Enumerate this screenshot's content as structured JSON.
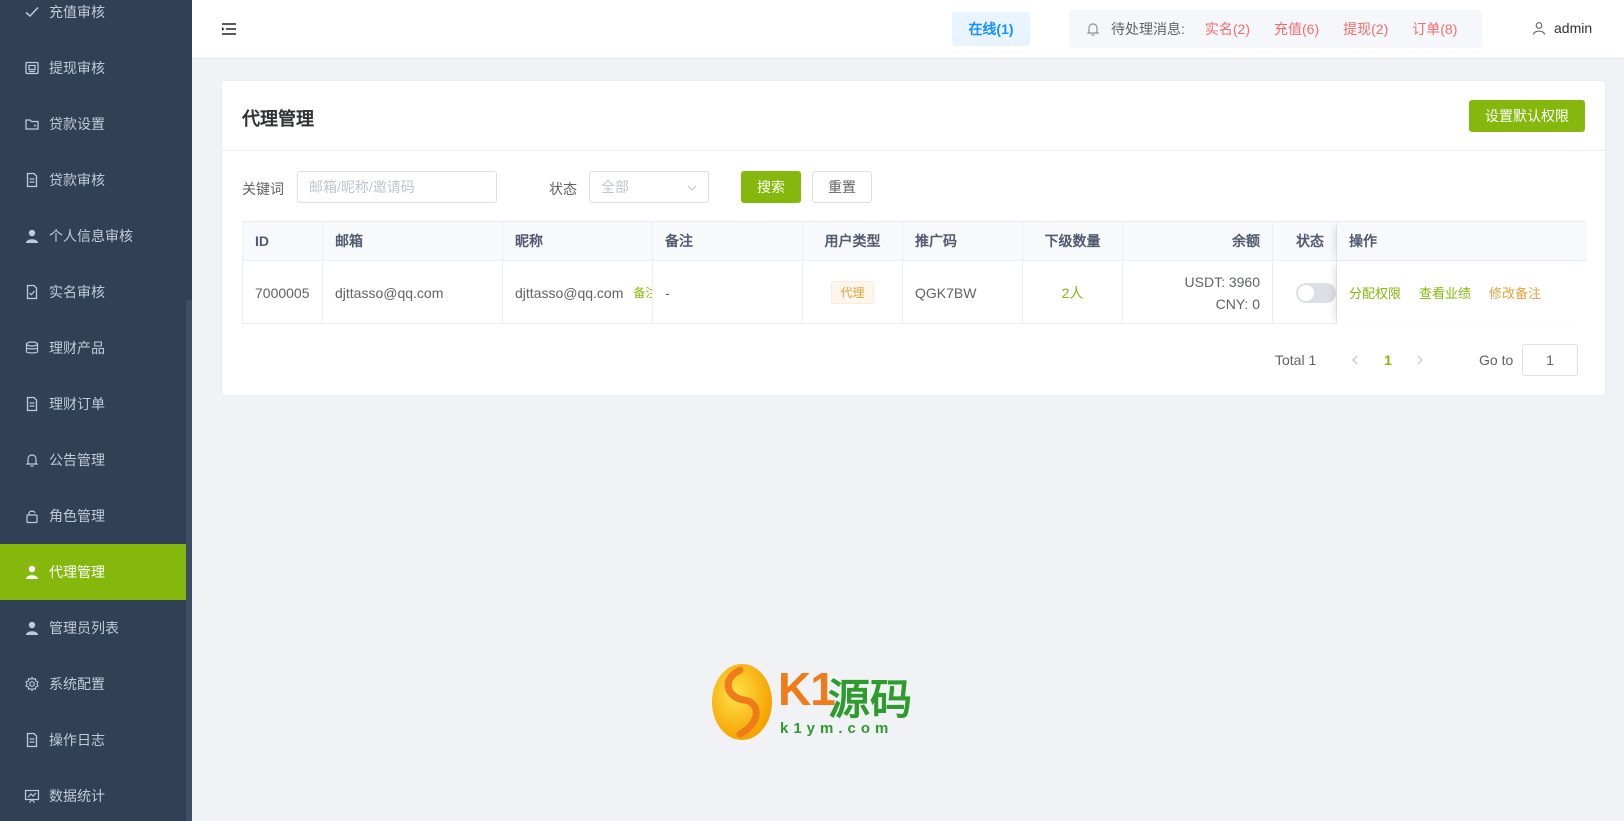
{
  "sidebar": {
    "items": [
      {
        "label": "充值审核",
        "icon": "check-icon"
      },
      {
        "label": "提现审核",
        "icon": "wallet-icon"
      },
      {
        "label": "贷款设置",
        "icon": "folder-icon"
      },
      {
        "label": "贷款审核",
        "icon": "document-icon"
      },
      {
        "label": "个人信息审核",
        "icon": "user-icon"
      },
      {
        "label": "实名审核",
        "icon": "document-check-icon"
      },
      {
        "label": "理财产品",
        "icon": "coins-icon"
      },
      {
        "label": "理财订单",
        "icon": "document-icon"
      },
      {
        "label": "公告管理",
        "icon": "bell-icon"
      },
      {
        "label": "角色管理",
        "icon": "lock-icon"
      },
      {
        "label": "代理管理",
        "icon": "user-icon",
        "active": true
      },
      {
        "label": "管理员列表",
        "icon": "user-icon"
      },
      {
        "label": "系统配置",
        "icon": "gear-icon"
      },
      {
        "label": "操作日志",
        "icon": "document-icon"
      },
      {
        "label": "数据统计",
        "icon": "chart-board-icon"
      }
    ]
  },
  "header": {
    "online": "在线(1)",
    "pending_label": "待处理消息:",
    "pending": [
      "实名(2)",
      "充值(6)",
      "提现(2)",
      "订单(8)"
    ],
    "username": "admin"
  },
  "card": {
    "title": "代理管理",
    "default_perm_button": "设置默认权限"
  },
  "filter": {
    "keyword_label": "关键词",
    "keyword_placeholder": "邮箱/昵称/邀请码",
    "status_label": "状态",
    "status_value": "全部",
    "search_button": "搜索",
    "reset_button": "重置"
  },
  "table": {
    "headers": [
      "ID",
      "邮箱",
      "昵称",
      "备注",
      "用户类型",
      "推广码",
      "下级数量",
      "余额",
      "状态",
      "操作"
    ],
    "rows": [
      {
        "id": "7000005",
        "email": "djttasso@qq.com",
        "nickname": "djttasso@qq.com",
        "nickname_tag": "备注",
        "remark": "-",
        "user_type": "代理",
        "promo_code": "QGK7BW",
        "sub_count": "2人",
        "balance_usdt": "USDT: 3960",
        "balance_cny": "CNY: 0",
        "status_on": false,
        "actions": [
          "分配权限",
          "查看业绩",
          "修改备注"
        ]
      }
    ]
  },
  "pagination": {
    "total": "Total 1",
    "current": "1",
    "goto_label": "Go to",
    "goto_value": "1"
  },
  "watermark": {
    "brand": "K1",
    "brand_cn": "源码",
    "url": "k1ym.com"
  },
  "colors": {
    "accent": "#85b80c",
    "sidebar_bg": "#304156",
    "danger": "#f56c6c",
    "info": "#1890ff",
    "warning": "#e6a23c"
  }
}
